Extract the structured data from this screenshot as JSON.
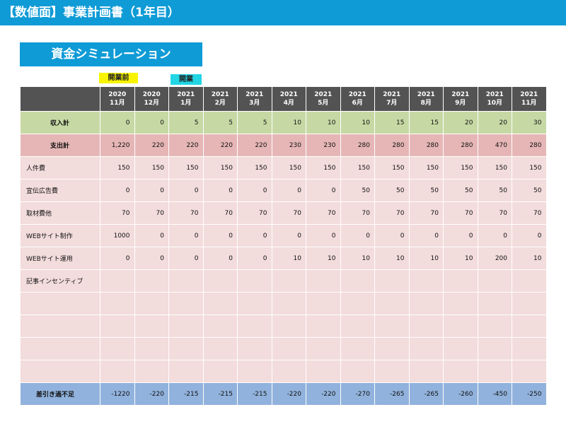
{
  "page": {
    "title": "【数値面】事業計画書（1年目）",
    "section_title": "資金シミュレーション",
    "tag_pre_open": "開業前",
    "tag_open": "開業"
  },
  "table": {
    "months": [
      {
        "year": "2020",
        "month": "11月"
      },
      {
        "year": "2020",
        "month": "12月"
      },
      {
        "year": "2021",
        "month": "1月"
      },
      {
        "year": "2021",
        "month": "2月"
      },
      {
        "year": "2021",
        "month": "3月"
      },
      {
        "year": "2021",
        "month": "4月"
      },
      {
        "year": "2021",
        "month": "5月"
      },
      {
        "year": "2021",
        "month": "6月"
      },
      {
        "year": "2021",
        "month": "7月"
      },
      {
        "year": "2021",
        "month": "8月"
      },
      {
        "year": "2021",
        "month": "9月"
      },
      {
        "year": "2021",
        "month": "10月"
      },
      {
        "year": "2021",
        "month": "11月"
      }
    ],
    "income": {
      "label": "収入計",
      "values": [
        "0",
        "0",
        "5",
        "5",
        "5",
        "10",
        "10",
        "10",
        "15",
        "15",
        "20",
        "20",
        "30"
      ]
    },
    "expense": {
      "label": "支出計",
      "values": [
        "1,220",
        "220",
        "220",
        "220",
        "220",
        "230",
        "230",
        "280",
        "280",
        "280",
        "280",
        "470",
        "280"
      ]
    },
    "items": [
      {
        "label": "人件費",
        "values": [
          "150",
          "150",
          "150",
          "150",
          "150",
          "150",
          "150",
          "150",
          "150",
          "150",
          "150",
          "150",
          "150"
        ]
      },
      {
        "label": "宣伝広告費",
        "values": [
          "0",
          "0",
          "0",
          "0",
          "0",
          "0",
          "0",
          "50",
          "50",
          "50",
          "50",
          "50",
          "50"
        ]
      },
      {
        "label": "取材費他",
        "values": [
          "70",
          "70",
          "70",
          "70",
          "70",
          "70",
          "70",
          "70",
          "70",
          "70",
          "70",
          "70",
          "70"
        ]
      },
      {
        "label": "WEBサイト制作",
        "values": [
          "1000",
          "0",
          "0",
          "0",
          "0",
          "0",
          "0",
          "0",
          "0",
          "0",
          "0",
          "0",
          "0"
        ]
      },
      {
        "label": "WEBサイト運用",
        "values": [
          "0",
          "0",
          "0",
          "0",
          "0",
          "10",
          "10",
          "10",
          "10",
          "10",
          "10",
          "200",
          "10"
        ]
      },
      {
        "label": "記事インセンティブ",
        "values": [
          "",
          "",
          "",
          "",
          "",
          "",
          "",
          "",
          "",
          "",
          "",
          "",
          ""
        ]
      }
    ],
    "empty_rows": 4,
    "balance": {
      "label": "差引き過不足",
      "values": [
        "-1220",
        "-220",
        "-215",
        "-215",
        "-215",
        "-220",
        "-220",
        "-270",
        "-265",
        "-265",
        "-260",
        "-450",
        "-250"
      ]
    }
  }
}
